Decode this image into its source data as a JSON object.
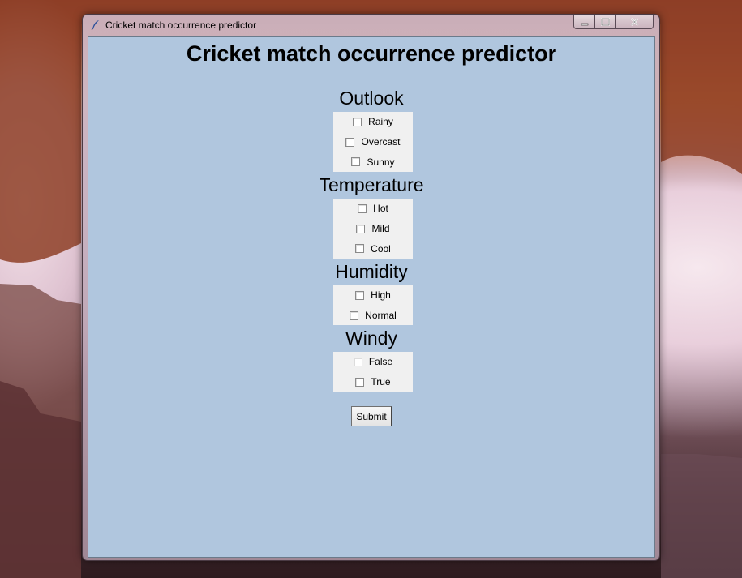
{
  "window": {
    "title": "Cricket match occurrence predictor"
  },
  "form": {
    "heading": "Cricket match occurrence predictor",
    "divider": "------------------------------------------------------------------------------------------------------------------------------------",
    "sections": [
      {
        "label": "Outlook",
        "options": [
          "Rainy",
          "Overcast",
          "Sunny"
        ]
      },
      {
        "label": "Temperature",
        "options": [
          "Hot",
          "Mild",
          "Cool"
        ]
      },
      {
        "label": "Humidity",
        "options": [
          "High",
          "Normal"
        ]
      },
      {
        "label": "Windy",
        "options": [
          "False",
          "True"
        ]
      }
    ],
    "checked": {
      "Outlook": [
        false,
        false,
        false
      ],
      "Temperature": [
        false,
        false,
        false
      ],
      "Humidity": [
        false,
        false
      ],
      "Windy": [
        false,
        false
      ]
    },
    "submit_label": "Submit"
  },
  "colors": {
    "client_background": "#b0c6de",
    "option_box_background": "#f0f0f0"
  },
  "icons": {
    "app": "feather-icon",
    "minimize": "minimize-icon",
    "maximize": "maximize-icon",
    "close": "close-icon"
  }
}
